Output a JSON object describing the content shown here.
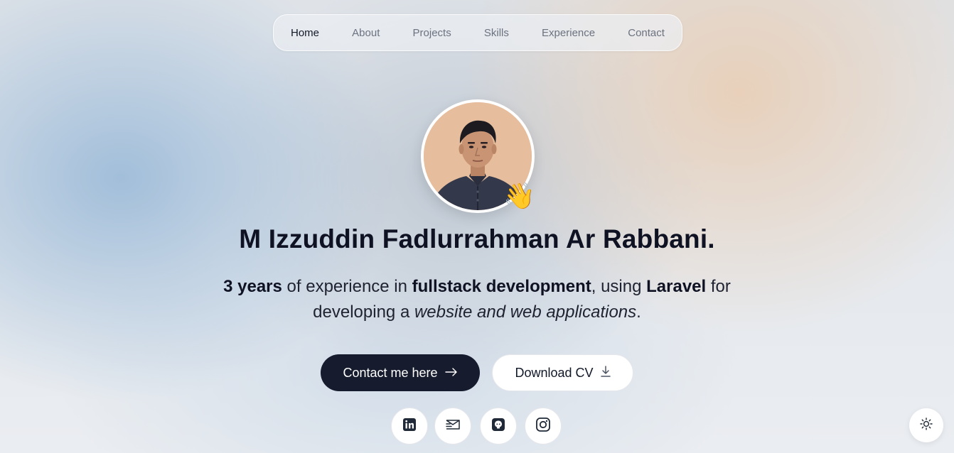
{
  "nav": {
    "items": [
      {
        "label": "Home",
        "active": true
      },
      {
        "label": "About",
        "active": false
      },
      {
        "label": "Projects",
        "active": false
      },
      {
        "label": "Skills",
        "active": false
      },
      {
        "label": "Experience",
        "active": false
      },
      {
        "label": "Contact",
        "active": false
      }
    ]
  },
  "hero": {
    "wave_emoji": "👋",
    "name": "M Izzuddin Fadlurrahman Ar Rabbani.",
    "tagline": {
      "p1_bold": "3 years",
      "p2": " of experience in ",
      "p3_bold": "fullstack development",
      "p4": ", using ",
      "p5_bold": "Laravel",
      "p6": " for developing a ",
      "p7_italic": "website and web applications",
      "p8": "."
    }
  },
  "actions": {
    "contact_label": "Contact me here",
    "contact_icon": "arrow-right-icon",
    "download_label": "Download CV",
    "download_icon": "download-icon"
  },
  "socials": [
    "linkedin-icon",
    "mail-icon",
    "github-icon",
    "instagram-icon"
  ],
  "theme_toggle_icon": "sun-icon",
  "colors": {
    "primary_button": "#161b2e",
    "text_dark": "#0f1222",
    "nav_inactive": "#6b7280"
  }
}
